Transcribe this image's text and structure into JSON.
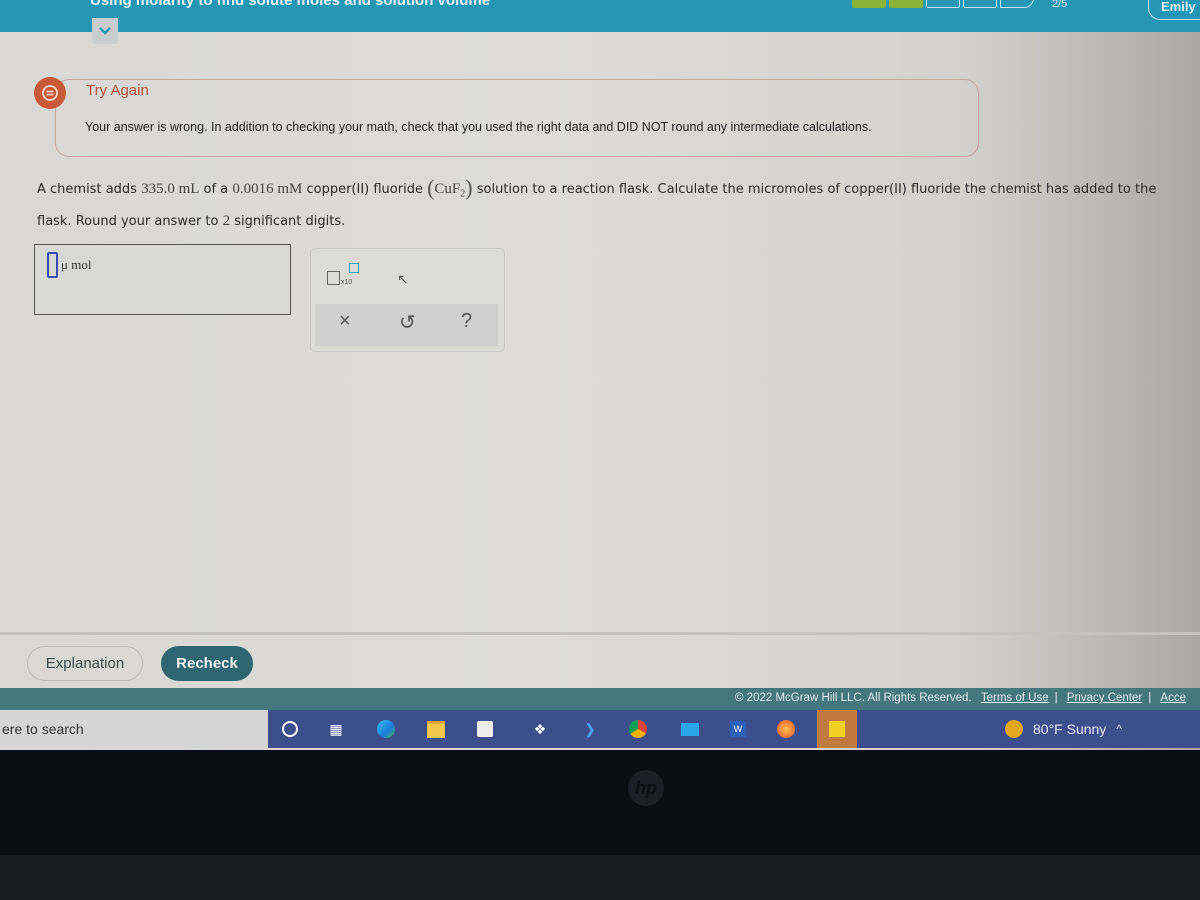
{
  "header": {
    "title": "Using molarity to find solute moles and solution volume",
    "progress": {
      "completed": 2,
      "total": 5,
      "label": "2/5"
    },
    "user_name": "Emily"
  },
  "feedback": {
    "title": "Try Again",
    "message": "Your answer is wrong. In addition to checking your math, check that you used the right data and DID NOT round any intermediate calculations."
  },
  "question": {
    "part1": "A chemist adds ",
    "volume": "335.0 mL",
    "part2": " of a ",
    "concentration": "0.0016 mM",
    "part3": " copper(II) fluoride ",
    "formula": "CuF",
    "formula_sub": "2",
    "part4": " solution to a reaction flask. Calculate the micromoles of copper(II) fluoride the chemist has added to the flask. Round your answer to ",
    "sigfigs": "2",
    "part5": " significant digits."
  },
  "answer": {
    "value": "",
    "unit": "μ mol"
  },
  "tools": {
    "sci_notation_label": "x10",
    "clear": "×",
    "undo": "↺",
    "help": "?"
  },
  "actions": {
    "explanation": "Explanation",
    "recheck": "Recheck"
  },
  "footer": {
    "copyright": "© 2022 McGraw Hill LLC. All Rights Reserved.",
    "terms": "Terms of Use",
    "privacy": "Privacy Center",
    "accessibility": "Acce"
  },
  "taskbar": {
    "search_placeholder": "ere to search",
    "weather": "80°F  Sunny"
  },
  "colors": {
    "accent": "#2596b3",
    "progress_done": "#8bb23a",
    "error": "#c85a38",
    "recheck": "#2f6672"
  }
}
